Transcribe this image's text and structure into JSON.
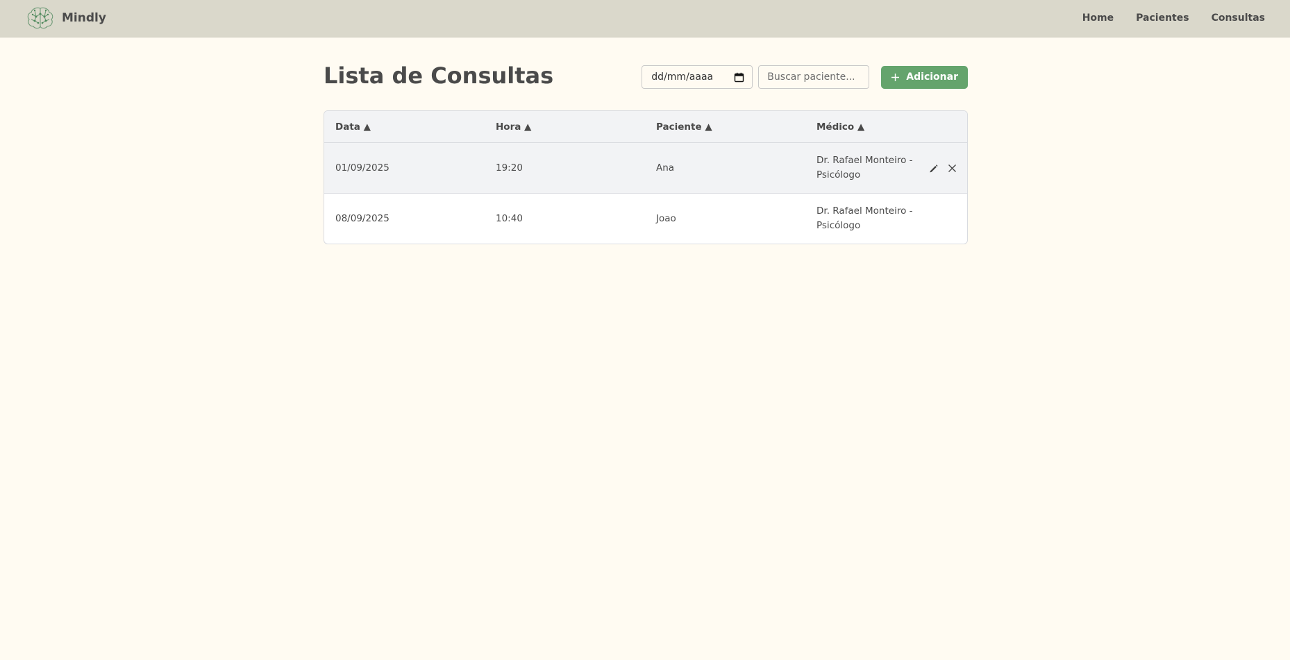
{
  "navbar": {
    "brand_name": "Mindly",
    "links": [
      "Home",
      "Pacientes",
      "Consultas"
    ]
  },
  "page": {
    "title": "Lista de Consultas"
  },
  "filters": {
    "date_placeholder": "dd/mm/aaaa",
    "search_placeholder": "Buscar paciente...",
    "add_label": "Adicionar"
  },
  "table": {
    "columns": [
      "Data ▲",
      "Hora ▲",
      "Paciente ▲",
      "Médico ▲"
    ],
    "rows": [
      {
        "data": "01/09/2025",
        "hora": "19:20",
        "paciente": "Ana",
        "medico": "Dr. Rafael Monteiro - Psicólogo"
      },
      {
        "data": "08/09/2025",
        "hora": "10:40",
        "paciente": "Joao",
        "medico": "Dr. Rafael Monteiro - Psicólogo"
      }
    ]
  },
  "icons": {
    "brand": "brain-icon",
    "calendar": "calendar-icon",
    "add": "plus-icon",
    "edit": "pencil-icon",
    "delete": "close-icon"
  },
  "colors": {
    "navbar_bg": "#dad8cb",
    "page_bg": "#fffbf2",
    "accent": "#64a46d",
    "text": "#4a4a4a"
  }
}
